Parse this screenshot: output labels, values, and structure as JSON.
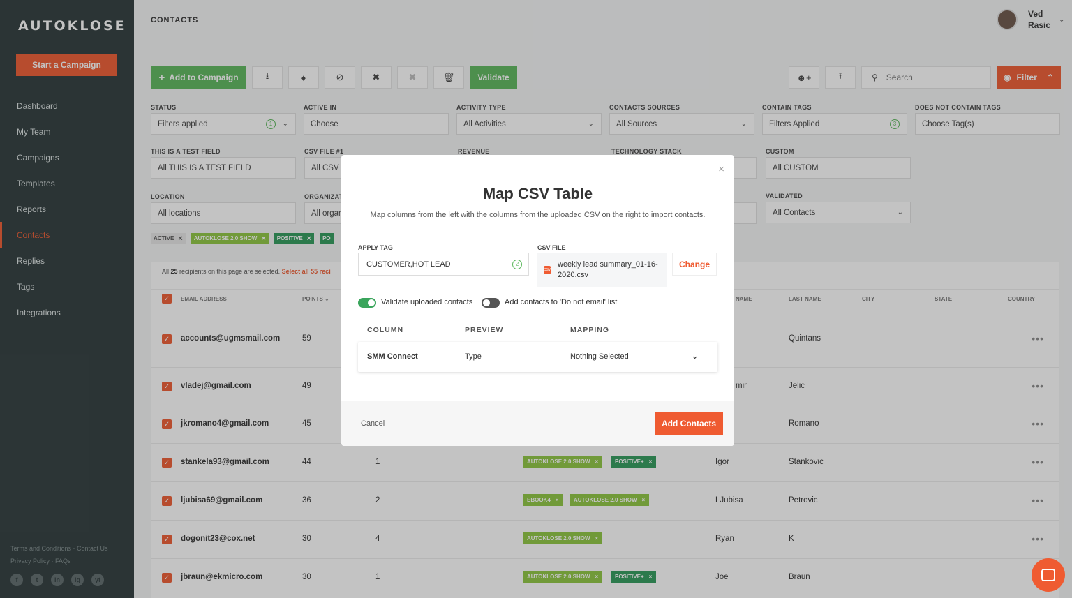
{
  "app": {
    "logo": "AUTOKLOSE"
  },
  "sidebar": {
    "start_label": "Start a Campaign",
    "items": [
      {
        "label": "Dashboard"
      },
      {
        "label": "My Team"
      },
      {
        "label": "Campaigns"
      },
      {
        "label": "Templates"
      },
      {
        "label": "Reports"
      },
      {
        "label": "Contacts",
        "active": true
      },
      {
        "label": "Replies"
      },
      {
        "label": "Tags"
      },
      {
        "label": "Integrations"
      }
    ],
    "footer_line1": "Terms and Conditions · Contact Us",
    "footer_line2": "Privacy Policy · FAQs",
    "social": [
      "f",
      "t",
      "in",
      "ig",
      "yt"
    ]
  },
  "header": {
    "title": "CONTACTS",
    "user_first": "Ved",
    "user_last": "Rasic"
  },
  "toolbar": {
    "add_label": "Add to Campaign",
    "validate_label": "Validate",
    "search_placeholder": "Search",
    "filter_label": "Filter"
  },
  "filters": {
    "status": {
      "label": "STATUS",
      "value": "Filters applied",
      "count": "1"
    },
    "active_in": {
      "label": "ACTIVE IN",
      "value": "Choose"
    },
    "activity_type": {
      "label": "ACTIVITY TYPE",
      "value": "All Activities"
    },
    "contact_sources": {
      "label": "CONTACTS SOURCES",
      "value": "All Sources"
    },
    "contain_tags": {
      "label": "CONTAIN TAGS",
      "value": "Filters Applied",
      "count": "3"
    },
    "not_contain_tags": {
      "label": "DOES NOT CONTAIN TAGS",
      "value": "Choose Tag(s)"
    },
    "test_field": {
      "label": "THIS IS A TEST FIELD",
      "value": "All THIS IS A TEST FIELD"
    },
    "csv_file": {
      "label": "CSV FILE #1",
      "value": "All CSV f"
    },
    "revenue": {
      "label": "REVENUE"
    },
    "tech_stack": {
      "label": "TECHNOLOGY STACK"
    },
    "custom": {
      "label": "CUSTOM",
      "value": "All CUSTOM"
    },
    "location": {
      "label": "LOCATION",
      "value": "All locations"
    },
    "organization": {
      "label": "ORGANIZAT",
      "value": "All organ"
    },
    "validated": {
      "label": "VALIDATED",
      "value": "All Contacts"
    }
  },
  "chips": [
    {
      "label": "ACTIVE",
      "style": "grey"
    },
    {
      "label": "AUTOKLOSE 2.0 SHOW",
      "style": "lime"
    },
    {
      "label": "POSITIVE",
      "style": "green"
    },
    {
      "label": "PO",
      "style": "green"
    }
  ],
  "table": {
    "selection_pre": "All ",
    "selection_count": "25",
    "selection_post": " recipients on this page are selected.",
    "selection_link": "Select all 55 reci",
    "headers": {
      "email": "EMAIL ADDRESS",
      "points": "POINTS",
      "name": "NAME",
      "last": "LAST NAME",
      "city": "CITY",
      "state": "STATE",
      "country": "COUNTRY"
    },
    "rows": [
      {
        "email": "accounts@ugmsmail.com",
        "points": "59",
        "campaigns": "",
        "first": "",
        "last": "Quintans",
        "tags": []
      },
      {
        "email": "vladej@gmail.com",
        "points": "49",
        "campaigns": "",
        "first": "mir",
        "last": "Jelic",
        "tags": []
      },
      {
        "email": "jkromano4@gmail.com",
        "points": "45",
        "campaigns": "",
        "first": "",
        "last": "Romano",
        "tags": []
      },
      {
        "email": "stankela93@gmail.com",
        "points": "44",
        "campaigns": "1",
        "first": "Igor",
        "last": "Stankovic",
        "tags": [
          {
            "label": "AUTOKLOSE 2.0 SHOW",
            "style": "lime"
          },
          {
            "label": "POSITIVE+",
            "style": "green"
          }
        ]
      },
      {
        "email": "ljubisa69@gmail.com",
        "points": "36",
        "campaigns": "2",
        "first": "LJubisa",
        "last": "Petrovic",
        "tags": [
          {
            "label": "EBOOK4",
            "style": "lime"
          },
          {
            "label": "AUTOKLOSE 2.0 SHOW",
            "style": "lime"
          }
        ]
      },
      {
        "email": "dogonit23@cox.net",
        "points": "30",
        "campaigns": "4",
        "first": "Ryan",
        "last": "K",
        "tags": [
          {
            "label": "AUTOKLOSE 2.0 SHOW",
            "style": "lime"
          }
        ]
      },
      {
        "email": "jbraun@ekmicro.com",
        "points": "30",
        "campaigns": "1",
        "first": "Joe",
        "last": "Braun",
        "tags": [
          {
            "label": "AUTOKLOSE 2.0 SHOW",
            "style": "lime"
          },
          {
            "label": "POSITIVE+",
            "style": "green"
          }
        ]
      }
    ]
  },
  "modal": {
    "title": "Map CSV Table",
    "subtitle": "Map columns from the left with the columns from the uploaded CSV on the right to import contacts.",
    "apply_tag_label": "APPLY TAG",
    "apply_tag_value": "CUSTOMER,HOT LEAD",
    "apply_tag_count": "2",
    "csv_file_label": "CSV FILE",
    "csv_icon_text": "CSV",
    "csv_file_name_1": "weekly lead summary_01-16-",
    "csv_file_name_2": "2020.csv",
    "change_label": "Change",
    "validate_toggle_label": "Validate uploaded contacts",
    "validate_on": true,
    "dne_toggle_label": "Add contacts to 'Do not email' list",
    "dne_on": false,
    "col_column": "COLUMN",
    "col_preview": "PREVIEW",
    "col_mapping": "MAPPING",
    "mapping_rows": [
      {
        "column": "SMM Connect",
        "preview": "Type",
        "mapping": "Nothing Selected"
      }
    ],
    "cancel_label": "Cancel",
    "submit_label": "Add Contacts"
  }
}
